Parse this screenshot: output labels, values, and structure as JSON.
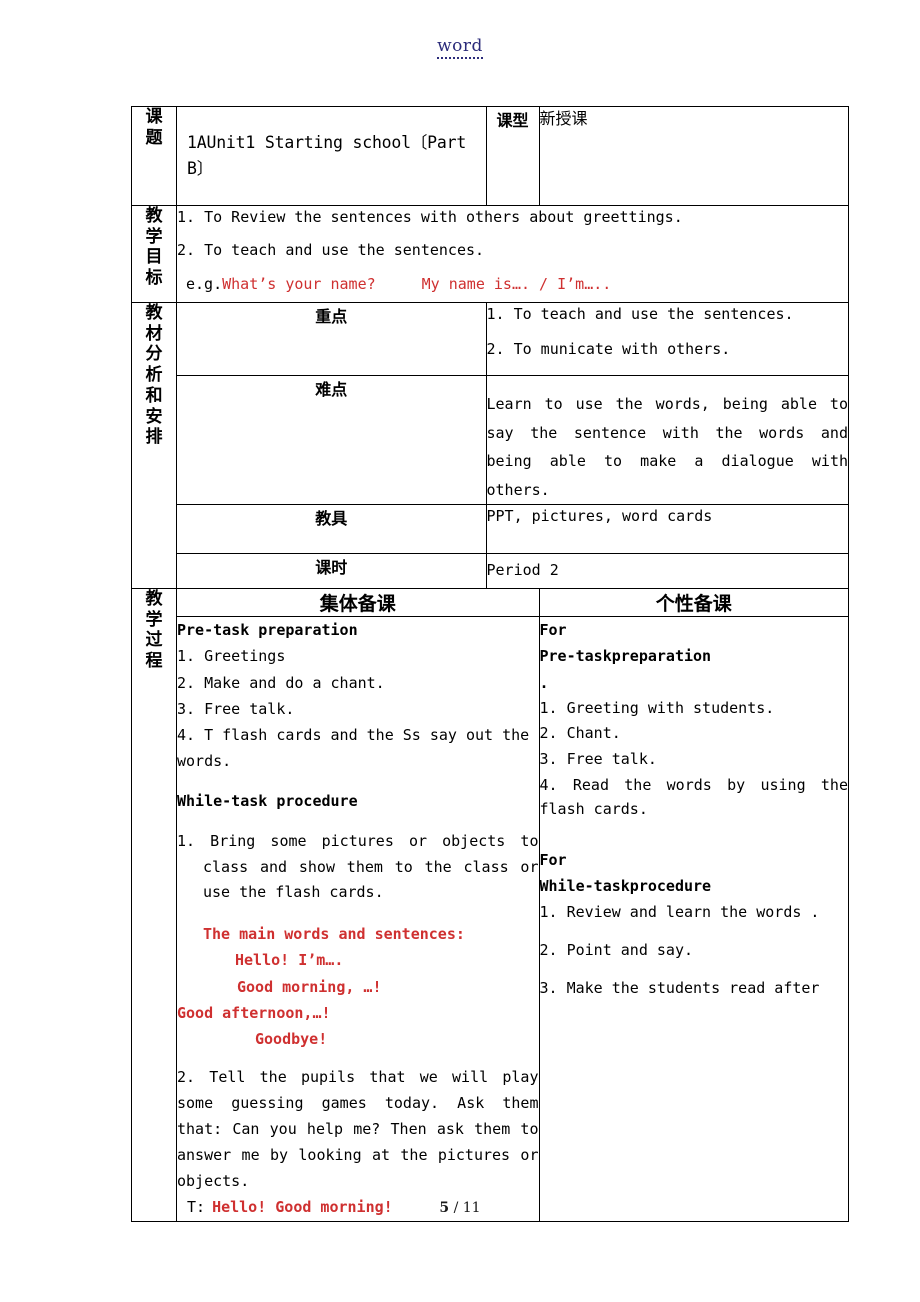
{
  "header": {
    "wordmark": "word"
  },
  "footer": {
    "page_current": "5",
    "separator": "/",
    "page_total": "11"
  },
  "colors": {
    "red_accent": "#cf3030",
    "wordmark": "#2b2b7a",
    "border": "#000000"
  },
  "table": {
    "topic_row": {
      "label": "课题",
      "label_chars": [
        "课",
        "题"
      ],
      "value": "1AUnit1 Starting school〔Part B〕",
      "type_label": "课型",
      "type_value": "新授课"
    },
    "objectives_row": {
      "label_chars": [
        "教",
        "学",
        "目",
        "标"
      ],
      "line1": "1. To Review the sentences with others about greettings.",
      "line2": "2. To teach and use the sentences.",
      "eg_prefix": "e.g.",
      "eg_red1": "What’s your name?",
      "eg_red2": "My name is….  /  I’m….."
    },
    "analysis_row": {
      "label_chars": [
        "教",
        "材",
        "分",
        "析",
        "和",
        "安",
        "排"
      ],
      "key_points": {
        "label": "重点",
        "line1": "1. To teach and use the sentences.",
        "line2": "2. To municate with others."
      },
      "difficulties": {
        "label": "难点",
        "text": "Learn to use the words, being able to say the sentence with the words and being able to make a dialogue with others."
      },
      "teaching_aids": {
        "label": "教具",
        "text": "PPT, pictures, word cards"
      },
      "periods": {
        "label": "课时",
        "text": "Period 2"
      }
    },
    "process_row": {
      "label_chars": [
        "教",
        "学",
        "过",
        "程"
      ],
      "col_head_left": "集体备课",
      "col_head_right": "个性备课",
      "collective": {
        "pretask_heading": "Pre-task preparation",
        "pretask_items": [
          "1. Greetings",
          "2. Make and do a chant.",
          "3. Free talk.",
          "4. T flash cards and the Ss say out the words."
        ],
        "while_heading": "While-task procedure",
        "while_item1": "1. Bring some pictures or objects to class and show them to the class or use the flash cards.",
        "main_words_label": "The main words and sentences:",
        "red_lines": [
          "Hello! I’m….",
          "Good morning, …!",
          "Good afternoon,…!",
          "Goodbye!"
        ],
        "while_item2": "2. Tell the pupils that we will play some guessing games today. Ask them that:  Can you help me? Then ask them to answer me by looking at the pictures or objects.",
        "teacher_prefix": "T:",
        "teacher_line": "Hello! Good morning!"
      },
      "personal": {
        "for1_label": "For",
        "for1_heading": "Pre-taskpreparation",
        "for1_dot": ".",
        "for1_items": [
          "1.   Greeting  with students.",
          "2. Chant.",
          "3. Free talk.",
          "4.  Read  the  words by using the flash cards."
        ],
        "for2_label": "For",
        "for2_heading": "While-taskprocedure",
        "for2_items": [
          "1. Review and learn the words .",
          "2. Point and say.",
          "3.     Make     the students read after"
        ]
      }
    }
  }
}
